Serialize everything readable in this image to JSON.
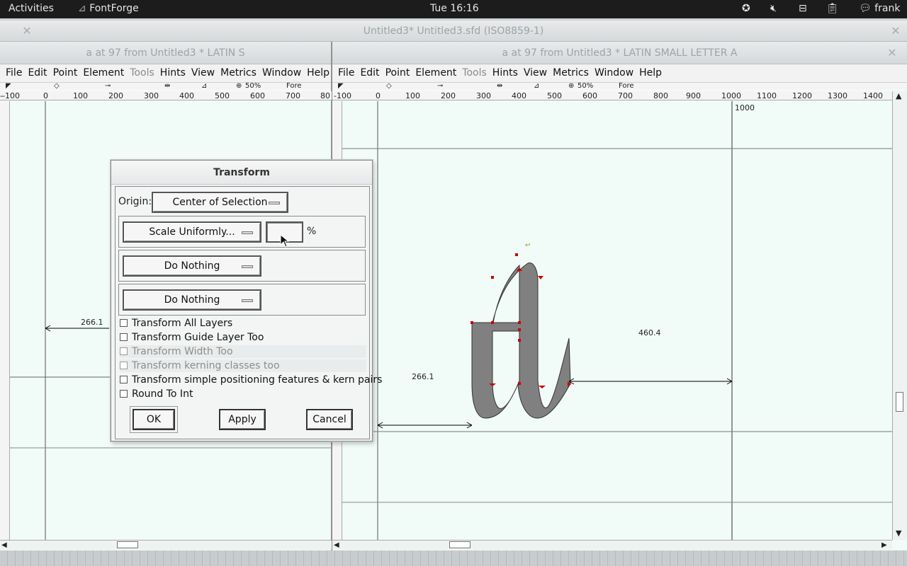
{
  "topbar": {
    "activities": "Activities",
    "app_name": "FontForge",
    "clock": "Tue 16:16",
    "user": "frank"
  },
  "background_window": {
    "title": "Untitled3*  Untitled3.sfd (ISO8859-1)"
  },
  "left_window": {
    "title": "a at 97 from Untitled3 * LATIN S",
    "menu": [
      "File",
      "Edit",
      "Point",
      "Element",
      "Tools",
      "Hints",
      "View",
      "Metrics",
      "Window",
      "Help"
    ],
    "disabled_menu": [
      "Tools"
    ],
    "toolrow": "50%",
    "layer": "Fore",
    "ruler_ticks": [
      "-100",
      "0",
      "100",
      "200",
      "300",
      "400",
      "500",
      "600",
      "700",
      "80"
    ],
    "left_bearing": "266.1"
  },
  "right_window": {
    "title": "a at 97 from Untitled3 * LATIN SMALL LETTER A",
    "menu": [
      "File",
      "Edit",
      "Point",
      "Element",
      "Tools",
      "Hints",
      "View",
      "Metrics",
      "Window",
      "Help"
    ],
    "disabled_menu": [
      "Tools"
    ],
    "toolrow": "50%",
    "layer": "Fore",
    "ruler_ticks": [
      "-100",
      "0",
      "100",
      "200",
      "300",
      "400",
      "500",
      "600",
      "700",
      "800",
      "900",
      "1000",
      "1100",
      "1200",
      "1300",
      "1400"
    ],
    "advance_width": "1000",
    "left_bearing": "266.1",
    "right_bearing": "460.4"
  },
  "dialog": {
    "title": "Transform",
    "origin_label": "Origin:",
    "origin_value": "Center of Selection",
    "row1_op": "Scale Uniformly...",
    "row1_value": "",
    "row1_unit": "%",
    "row2_op": "Do Nothing",
    "row3_op": "Do Nothing",
    "options": [
      {
        "label": "Transform All Layers",
        "checked": false,
        "enabled": true
      },
      {
        "label": "Transform Guide Layer Too",
        "checked": false,
        "enabled": true
      },
      {
        "label": "Transform Width Too",
        "checked": false,
        "enabled": false
      },
      {
        "label": "Transform kerning classes too",
        "checked": false,
        "enabled": false
      },
      {
        "label": "Transform simple positioning features & kern pairs",
        "checked": false,
        "enabled": true
      },
      {
        "label": "Round To Int",
        "checked": false,
        "enabled": true
      }
    ],
    "ok": "OK",
    "apply": "Apply",
    "cancel": "Cancel"
  }
}
